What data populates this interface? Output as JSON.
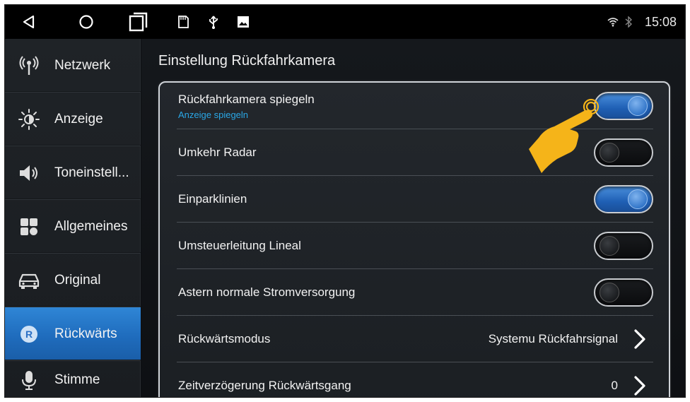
{
  "statusbar": {
    "clock": "15:08",
    "icons": [
      "back-icon",
      "home-icon",
      "recents-icon",
      "sd-card-icon",
      "usb-icon",
      "image-icon",
      "wifi-icon",
      "bluetooth-icon"
    ]
  },
  "sidebar": {
    "items": [
      {
        "label": "Netzwerk",
        "icon": "network-icon",
        "active": false
      },
      {
        "label": "Anzeige",
        "icon": "brightness-icon",
        "active": false
      },
      {
        "label": "Toneinstell...",
        "icon": "speaker-icon",
        "active": false
      },
      {
        "label": "Allgemeines",
        "icon": "grid-icon",
        "active": false
      },
      {
        "label": "Original",
        "icon": "car-icon",
        "active": false
      },
      {
        "label": "Rückwärts",
        "icon": "reverse-icon",
        "active": true
      },
      {
        "label": "Stimme",
        "icon": "microphone-icon",
        "active": false
      }
    ]
  },
  "main": {
    "title": "Einstellung Rückfahrkamera",
    "rows": [
      {
        "title": "Rückfahrkamera spiegeln",
        "subtitle": "Anzeige spiegeln",
        "type": "toggle",
        "on": true
      },
      {
        "title": "Umkehr Radar",
        "type": "toggle",
        "on": false
      },
      {
        "title": "Einparklinien",
        "type": "toggle",
        "on": true
      },
      {
        "title": "Umsteuerleitung Lineal",
        "type": "toggle",
        "on": false
      },
      {
        "title": "Astern normale Stromversorgung",
        "type": "toggle",
        "on": false
      },
      {
        "title": "Rückwärtsmodus",
        "type": "select",
        "value": "Systemu Rückfahrsignal"
      },
      {
        "title": "Zeitverzögerung Rückwärtsgang",
        "type": "select",
        "value": "0"
      }
    ]
  },
  "colors": {
    "accent_blue": "#1f6cbd",
    "subtitle_blue": "#2aa7e6",
    "pointer_hand": "#f5b419"
  }
}
